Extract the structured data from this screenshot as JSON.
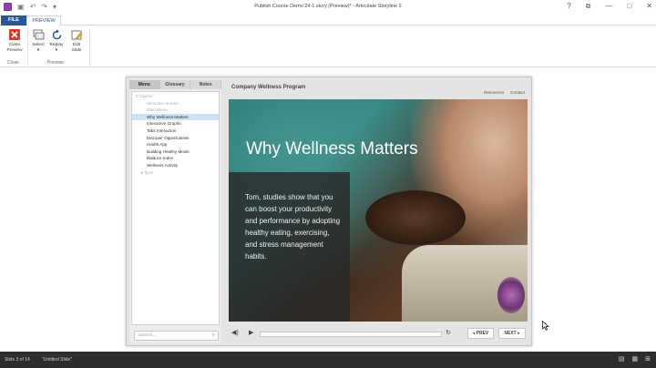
{
  "window": {
    "title": "Publish Course Demo 24-1.story (Preview)* - Articulate Storyline 2",
    "quick_access": {
      "save_icon": "save-icon",
      "undo_icon": "undo-icon",
      "redo_icon": "redo-icon"
    },
    "controls": {
      "help": "?",
      "restore": "⧉",
      "minimize": "—",
      "maximize": "□",
      "close": "✕"
    }
  },
  "ribbon": {
    "tabs": {
      "file": "FILE",
      "preview": "PREVIEW"
    },
    "buttons": {
      "close_preview": "Close\nPreview",
      "select": "Select\n▾",
      "replay": "Replay\n▾",
      "edit_slide": "Edit\nSlide"
    },
    "groups": {
      "close": "Close",
      "preview": "Preview"
    }
  },
  "player": {
    "course_title": "Company Wellness Program",
    "links": {
      "resources": "Resources",
      "contact": "Contact"
    },
    "sidebar_tabs": [
      "Menu",
      "Glossary",
      "Notes"
    ],
    "menu": {
      "root": "▾  Course",
      "items": [
        "Welcome Screen",
        "Main Menu",
        "Why Wellness Matters",
        "Interactive Graphic",
        "Tabs Interaction",
        "Discover Opportunities",
        "Health App",
        "Building Healthy Meals",
        "Balance Index",
        "Wellness Activity"
      ],
      "selected_index": 2,
      "quiz": "▸  Quiz"
    },
    "search_placeholder": "Search...",
    "slide": {
      "title": "Why Wellness Matters",
      "body": "Tom, studies show that you can boost your productivity and performance by adopting healthy eating, exercising, and stress management habits."
    },
    "nav": {
      "prev": "◂ PREV",
      "next": "NEXT ▸"
    }
  },
  "status": {
    "slide": "Slide 3 of 14",
    "layout": "\"Untitled Slide\""
  },
  "colors": {
    "file_tab": "#2b579a",
    "status_bar": "#2d2d30",
    "menu_selection": "#cfe0f2",
    "close_icon": "#d9382b"
  }
}
